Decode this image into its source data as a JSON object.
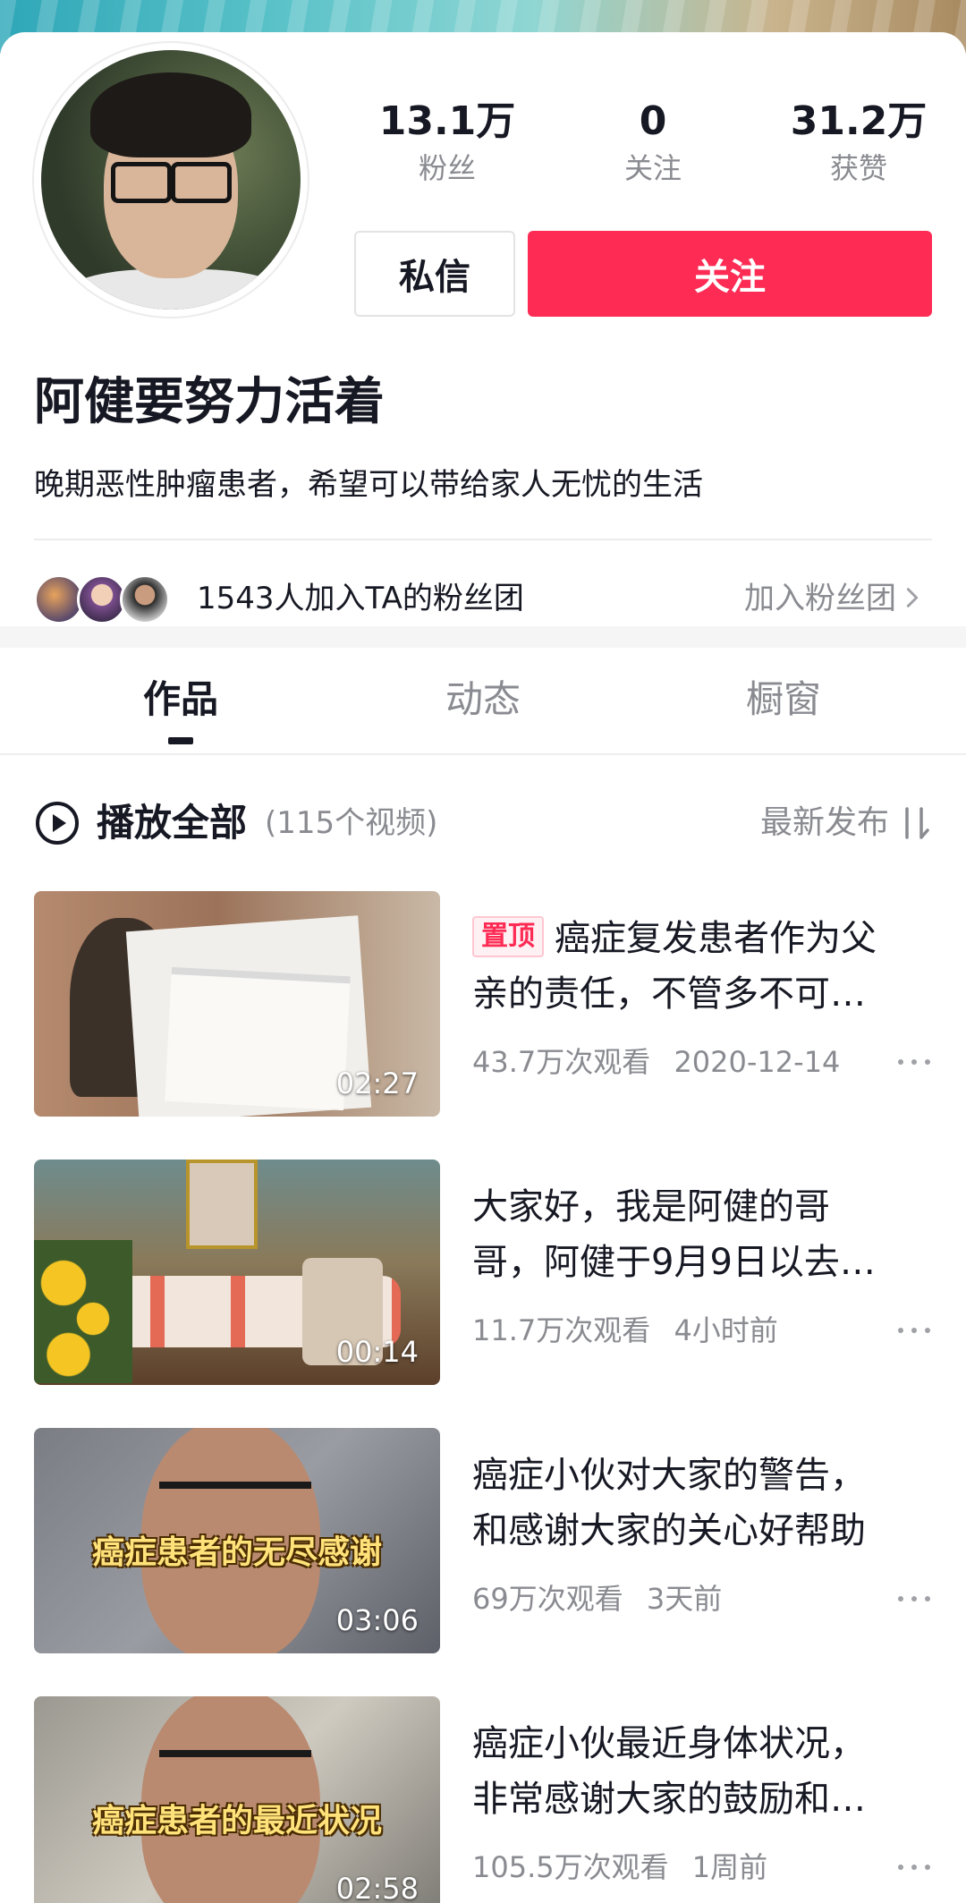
{
  "profile": {
    "nickname": "阿健要努力活着",
    "bio": "晚期恶性肿瘤患者，希望可以带给家人无忧的生活",
    "stats": [
      {
        "value": "13.1万",
        "label": "粉丝"
      },
      {
        "value": "0",
        "label": "关注"
      },
      {
        "value": "31.2万",
        "label": "获赞"
      }
    ],
    "message_button": "私信",
    "follow_button": "关注"
  },
  "fan_group": {
    "text": "1543人加入TA的粉丝团",
    "join_label": "加入粉丝团"
  },
  "tabs": [
    {
      "label": "作品",
      "active": true
    },
    {
      "label": "动态",
      "active": false
    },
    {
      "label": "橱窗",
      "active": false
    }
  ],
  "playall": {
    "label": "播放全部",
    "count": "(115个视频)",
    "sort_label": "最新发布"
  },
  "videos": [
    {
      "pinned_label": "置顶",
      "title_line1": "癌症复发患者作为父",
      "title_line2": "亲的责任，不管多不可…",
      "views": "43.7万次观看",
      "time": "2020-12-14",
      "duration": "02:27",
      "overlay": ""
    },
    {
      "pinned_label": "",
      "title_line1": "大家好，我是阿健的哥",
      "title_line2": "哥，阿健于9月9日以去…",
      "views": "11.7万次观看",
      "time": "4小时前",
      "duration": "00:14",
      "overlay": ""
    },
    {
      "pinned_label": "",
      "title_line1": "癌症小伙对大家的警告，",
      "title_line2": "和感谢大家的关心好帮助",
      "views": "69万次观看",
      "time": "3天前",
      "duration": "03:06",
      "overlay": "癌症患者的无尽感谢"
    },
    {
      "pinned_label": "",
      "title_line1": "癌症小伙最近身体状况，",
      "title_line2": "非常感谢大家的鼓励和…",
      "views": "105.5万次观看",
      "time": "1周前",
      "duration": "02:58",
      "overlay": "癌症患者的最近状况"
    }
  ],
  "colors": {
    "accent": "#fe2c55",
    "text_primary": "#161823",
    "text_secondary": "#8a8b91"
  },
  "icons": {
    "play_all": "play-circle-icon",
    "sort": "sort-icon",
    "chevron": "chevron-right-icon",
    "more": "more-dots-icon"
  }
}
